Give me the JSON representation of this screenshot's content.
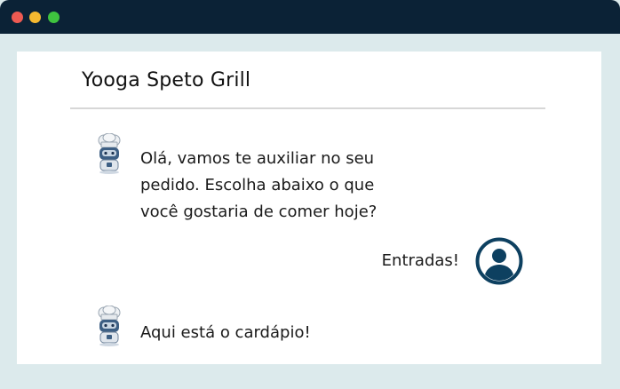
{
  "window": {
    "controls": {
      "close_color": "#ee5a52",
      "minimize_color": "#f4b830",
      "maximize_color": "#3fc33f"
    },
    "titlebar_color": "#0b2236"
  },
  "chat": {
    "title": "Yooga Speto Grill",
    "messages": [
      {
        "sender": "bot",
        "avatar_icon": "chef-robot-icon",
        "lines": [
          "Olá, vamos te auxiliar no seu",
          "pedido. Escolha abaixo o que",
          "você gostaria de comer hoje?"
        ]
      },
      {
        "sender": "user",
        "avatar_icon": "user-profile-icon",
        "text": "Entradas!"
      },
      {
        "sender": "bot",
        "avatar_icon": "chef-robot-icon",
        "lines": [
          "Aqui está o cardápio!"
        ]
      }
    ]
  },
  "colors": {
    "accent": "#0d4060",
    "background": "#dceaec",
    "panel": "#ffffff"
  }
}
